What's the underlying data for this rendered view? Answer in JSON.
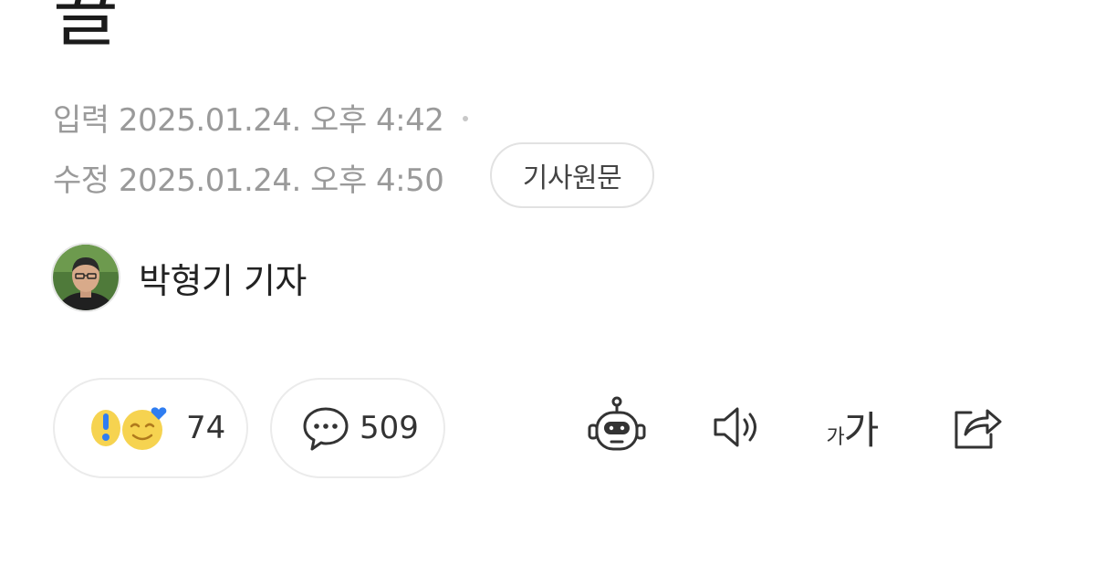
{
  "article": {
    "title_fragment": "끌"
  },
  "meta": {
    "input_label": "입력",
    "input_datetime": "2025.01.24. 오후 4:42",
    "edit_label": "수정",
    "edit_datetime": "2025.01.24. 오후 4:50",
    "original_button": "기사원문"
  },
  "reporter": {
    "name": "박형기 기자"
  },
  "actions": {
    "reaction_count": "74",
    "comment_count": "509"
  },
  "tools": {
    "font_small": "가",
    "font_large": "가",
    "icons": [
      "robot-icon",
      "speaker-icon",
      "font-size-icon",
      "share-icon"
    ]
  },
  "colors": {
    "meta_text": "#9a9a9a",
    "emoji_yellow": "#f6d350",
    "emoji_blue": "#2f7df1"
  }
}
